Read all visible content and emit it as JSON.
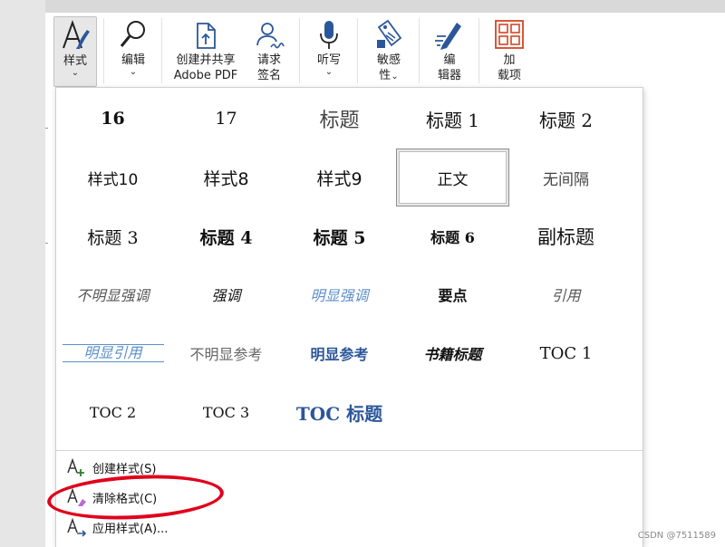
{
  "ribbon": {
    "styles_label": "样式",
    "edit_label": "编辑",
    "adobe_line1": "创建并共享",
    "adobe_line2": "Adobe PDF",
    "sign_line1": "请求",
    "sign_line2": "签名",
    "dictate_label": "听写",
    "sensitivity_line1": "敏感",
    "sensitivity_line2": "性",
    "editor_line1": "编",
    "editor_line2": "辑器",
    "addins_line1": "加",
    "addins_line2": "载项",
    "chevron": "⌄"
  },
  "gallery": {
    "r1": [
      "16",
      "17",
      "标题",
      "标题 1",
      "标题 2"
    ],
    "r2": [
      "样式10",
      "样式8",
      "样式9",
      "正文",
      "无间隔"
    ],
    "r3": [
      "标题 3",
      "标题 4",
      "标题 5",
      "标题 6",
      "副标题"
    ],
    "r4": [
      "不明显强调",
      "强调",
      "明显强调",
      "要点",
      "引用"
    ],
    "r5": [
      "明显引用",
      "不明显参考",
      "明显参考",
      "书籍标题",
      "TOC 1"
    ],
    "r6": [
      "TOC 2",
      "TOC 3",
      "TOC 标题"
    ]
  },
  "menu": {
    "create_style": "创建样式(S)",
    "clear_formatting": "清除格式(C)",
    "apply_styles": "应用样式(A)..."
  },
  "watermark": "CSDN @7511589",
  "colors": {
    "accent_blue": "#2b579a",
    "light_blue": "#5b8fc9",
    "annotation_red": "#e0001b"
  }
}
